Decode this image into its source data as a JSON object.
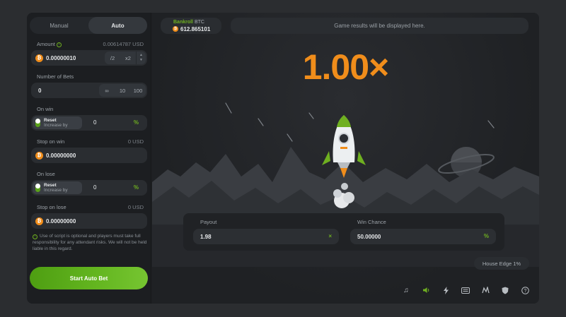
{
  "tabs": {
    "manual": "Manual",
    "auto": "Auto"
  },
  "amount": {
    "label": "Amount",
    "usd": "0.00614787 USD",
    "value": "0.00000010",
    "half": "/2",
    "double": "x2"
  },
  "bets": {
    "label": "Number of Bets",
    "value": "0",
    "opt_inf": "∞",
    "opt_10": "10",
    "opt_100": "100"
  },
  "on_win": {
    "label": "On win",
    "reset": "Reset",
    "increase": "Increase by",
    "value": "0",
    "unit": "%"
  },
  "stop_win": {
    "label": "Stop on win",
    "usd": "0 USD",
    "value": "0.00000000"
  },
  "on_lose": {
    "label": "On lose",
    "reset": "Reset",
    "increase": "Increase by",
    "value": "0",
    "unit": "%"
  },
  "stop_lose": {
    "label": "Stop on lose",
    "usd": "0 USD",
    "value": "0.00000000"
  },
  "note": "Use of script is optional and players must take full responsibility for any attendant risks. We will not be held liable in this regard.",
  "start_button": "Start Auto Bet",
  "bankroll": {
    "title": "Bankroll",
    "currency": "BTC",
    "value": "612.865101"
  },
  "results_text": "Game results will be displayed here.",
  "multiplier": "1.00×",
  "payout": {
    "label": "Payout",
    "value": "1.98",
    "suffix": "×"
  },
  "win_chance": {
    "label": "Win Chance",
    "value": "50.00000",
    "suffix": "%"
  },
  "house_edge": "House Edge 1%",
  "icons": [
    "music-icon",
    "volume-icon",
    "lightning-icon",
    "keyboard-icon",
    "chart-icon",
    "shield-icon",
    "help-icon"
  ],
  "colors": {
    "accent": "#6fb020",
    "multiplier": "#f08d1b",
    "coin": "#f08d1b"
  }
}
